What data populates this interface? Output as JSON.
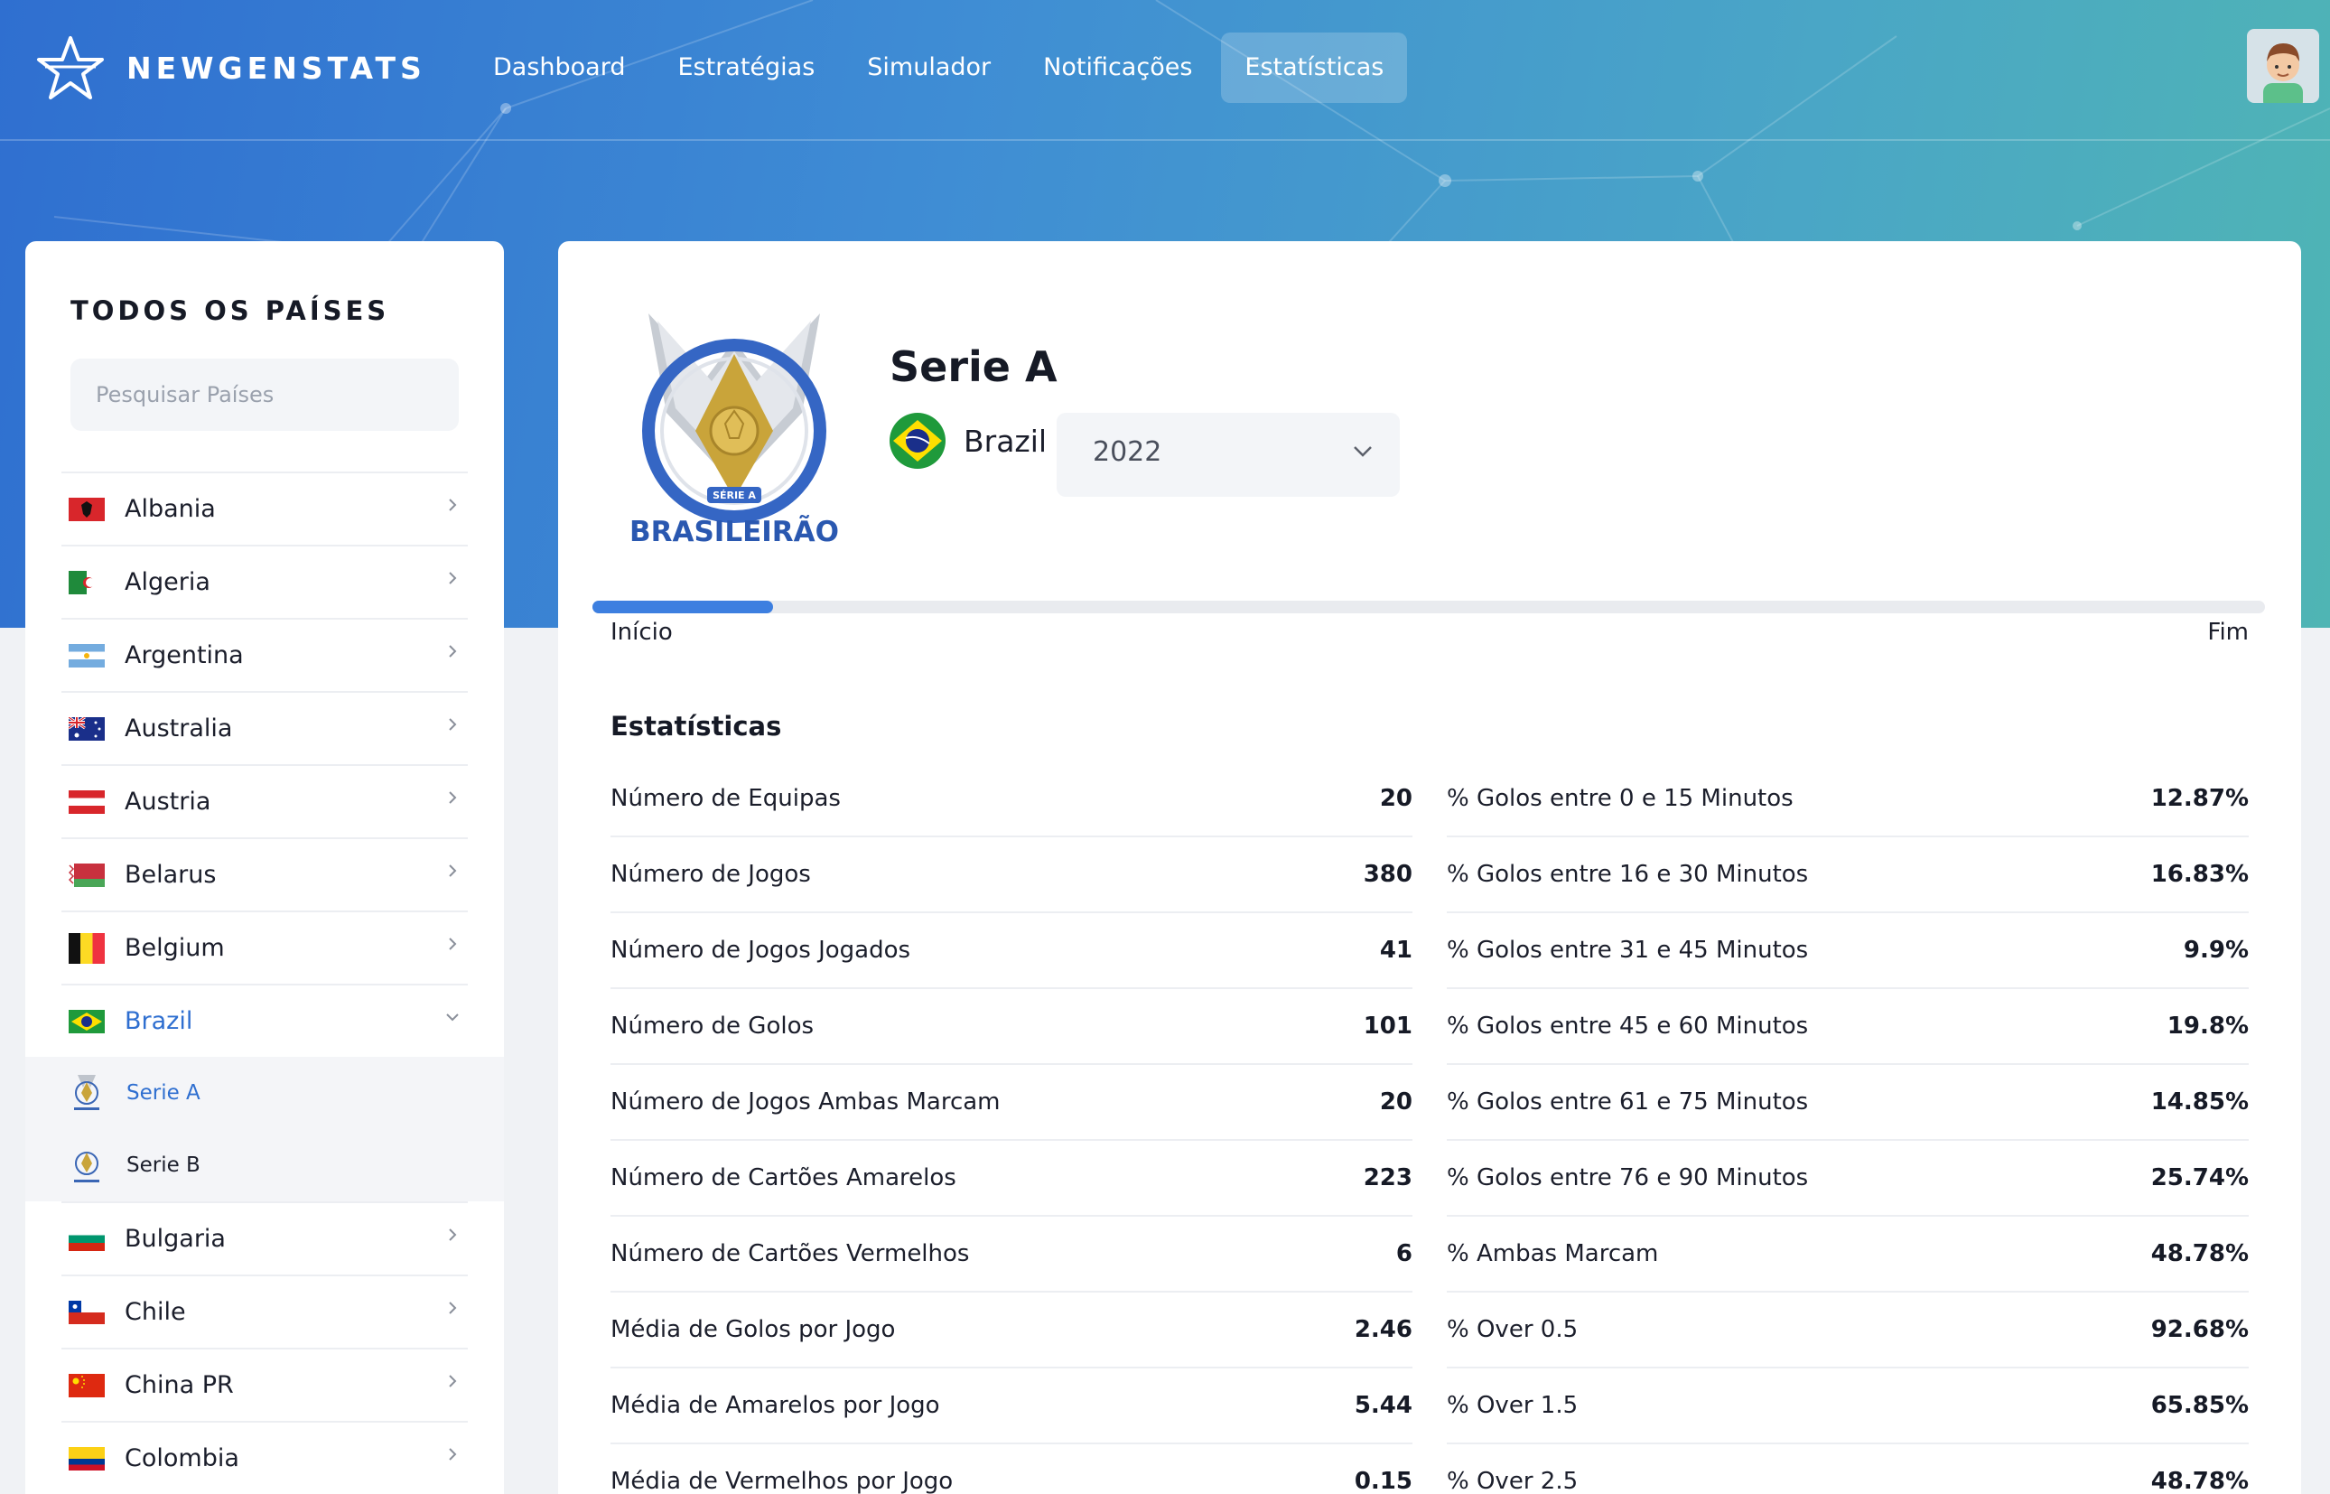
{
  "brand": {
    "name": "NEWGENSTATS"
  },
  "nav": [
    {
      "label": "Dashboard",
      "active": false
    },
    {
      "label": "Estratégias",
      "active": false
    },
    {
      "label": "Simulador",
      "active": false
    },
    {
      "label": "Notificações",
      "active": false
    },
    {
      "label": "Estatísticas",
      "active": true
    }
  ],
  "sidebar": {
    "title": "TODOS OS PAÍSES",
    "search_placeholder": "Pesquisar Países",
    "countries": [
      {
        "name": "Albania",
        "flag": "albania"
      },
      {
        "name": "Algeria",
        "flag": "algeria"
      },
      {
        "name": "Argentina",
        "flag": "argentina"
      },
      {
        "name": "Australia",
        "flag": "australia"
      },
      {
        "name": "Austria",
        "flag": "austria"
      },
      {
        "name": "Belarus",
        "flag": "belarus"
      },
      {
        "name": "Belgium",
        "flag": "belgium"
      },
      {
        "name": "Brazil",
        "flag": "brazil",
        "open": true
      },
      {
        "name": "Bulgaria",
        "flag": "bulgaria"
      },
      {
        "name": "Chile",
        "flag": "chile"
      },
      {
        "name": "China PR",
        "flag": "china"
      },
      {
        "name": "Colombia",
        "flag": "colombia"
      }
    ],
    "leagues": [
      {
        "name": "Serie A",
        "active": true
      },
      {
        "name": "Serie B",
        "active": false
      }
    ]
  },
  "league": {
    "name": "Serie A",
    "crest_text": "BRASILEIRÃO",
    "crest_badge": "SÉRIE A",
    "country": "Brazil",
    "season": "2022",
    "progress_fraction": 0.108,
    "progress_start": "Início",
    "progress_end": "Fim"
  },
  "stats": {
    "title": "Estatísticas",
    "left": [
      {
        "label": "Número de Equipas",
        "value": "20"
      },
      {
        "label": "Número de Jogos",
        "value": "380"
      },
      {
        "label": "Número de Jogos Jogados",
        "value": "41"
      },
      {
        "label": "Número de Golos",
        "value": "101"
      },
      {
        "label": "Número de Jogos Ambas Marcam",
        "value": "20"
      },
      {
        "label": "Número de Cartões Amarelos",
        "value": "223"
      },
      {
        "label": "Número de Cartões Vermelhos",
        "value": "6"
      },
      {
        "label": "Média de Golos por Jogo",
        "value": "2.46"
      },
      {
        "label": "Média de Amarelos por Jogo",
        "value": "5.44"
      },
      {
        "label": "Média de Vermelhos por Jogo",
        "value": "0.15"
      }
    ],
    "right": [
      {
        "label": "% Golos entre 0 e 15 Minutos",
        "value": "12.87%"
      },
      {
        "label": "% Golos entre 16 e 30 Minutos",
        "value": "16.83%"
      },
      {
        "label": "% Golos entre 31 e 45 Minutos",
        "value": "9.9%"
      },
      {
        "label": "% Golos entre 45 e 60 Minutos",
        "value": "19.8%"
      },
      {
        "label": "% Golos entre 61 e 75 Minutos",
        "value": "14.85%"
      },
      {
        "label": "% Golos entre 76 e 90 Minutos",
        "value": "25.74%"
      },
      {
        "label": "% Ambas Marcam",
        "value": "48.78%"
      },
      {
        "label": "% Over 0.5",
        "value": "92.68%"
      },
      {
        "label": "% Over 1.5",
        "value": "65.85%"
      },
      {
        "label": "% Over 2.5",
        "value": "48.78%"
      }
    ]
  },
  "colors": {
    "accent": "#2f6fd0",
    "progress": "#3d7fe0"
  }
}
